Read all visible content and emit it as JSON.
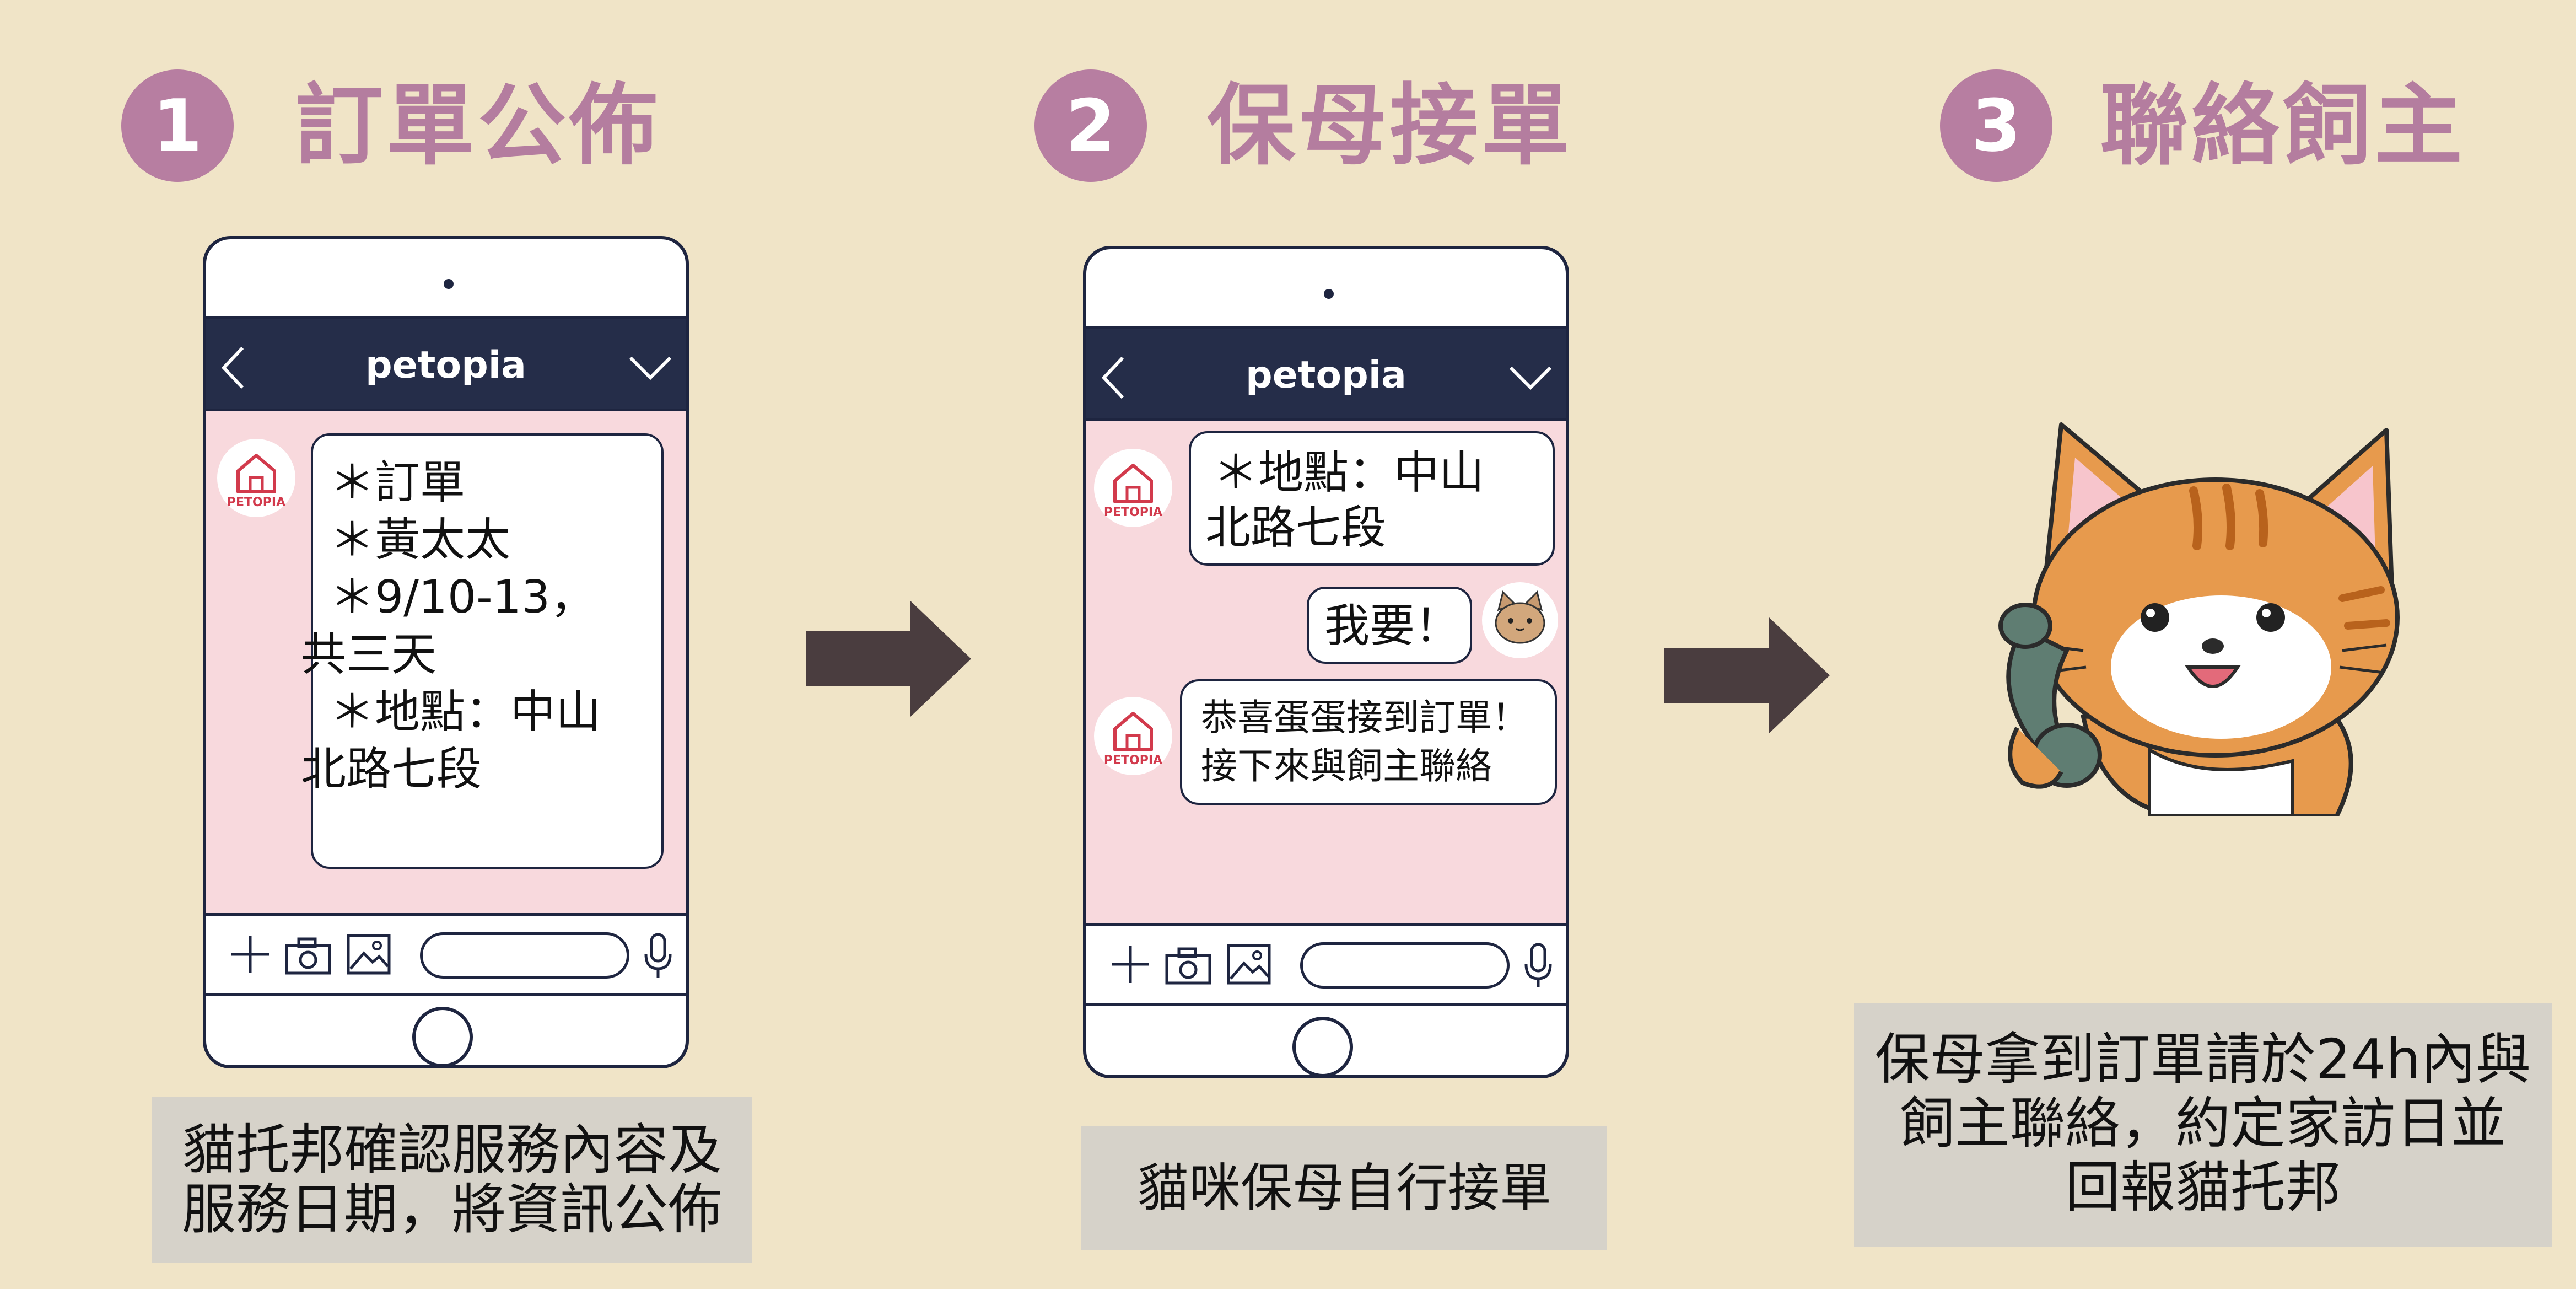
{
  "steps": [
    {
      "number": "1",
      "title": "訂單公佈",
      "app_name": "petopia",
      "messages": [
        {
          "sender": "bot",
          "lines": [
            "＊訂單",
            "＊黃太太",
            "＊9/10-13，",
            "共三天",
            "＊地點：中山",
            "北路七段"
          ]
        }
      ],
      "caption_lines": [
        "貓托邦確認服務內容及",
        "服務日期，將資訊公佈"
      ]
    },
    {
      "number": "2",
      "title": "保母接單",
      "app_name": "petopia",
      "messages": [
        {
          "sender": "bot",
          "lines": [
            "＊地點：中山",
            "北路七段"
          ]
        },
        {
          "sender": "user",
          "lines": [
            "我要！"
          ]
        },
        {
          "sender": "bot",
          "lines": [
            "恭喜蛋蛋接到訂單！",
            "接下來與飼主聯絡"
          ]
        }
      ],
      "caption_lines": [
        "貓咪保母自行接單"
      ]
    },
    {
      "number": "3",
      "title": "聯絡飼主",
      "caption_lines": [
        "保母拿到訂單請於24h內與",
        "飼主聯絡，約定家訪日並",
        "回報貓托邦"
      ]
    }
  ],
  "avatar_label": "PETOPIA",
  "colors": {
    "background": "#f0e4c7",
    "accent": "#b77ea1",
    "phone_header": "#252d49",
    "chat_bg": "#f8d9dd",
    "arrow": "#4a3d3f",
    "caption_bg": "#d6d2c9"
  }
}
